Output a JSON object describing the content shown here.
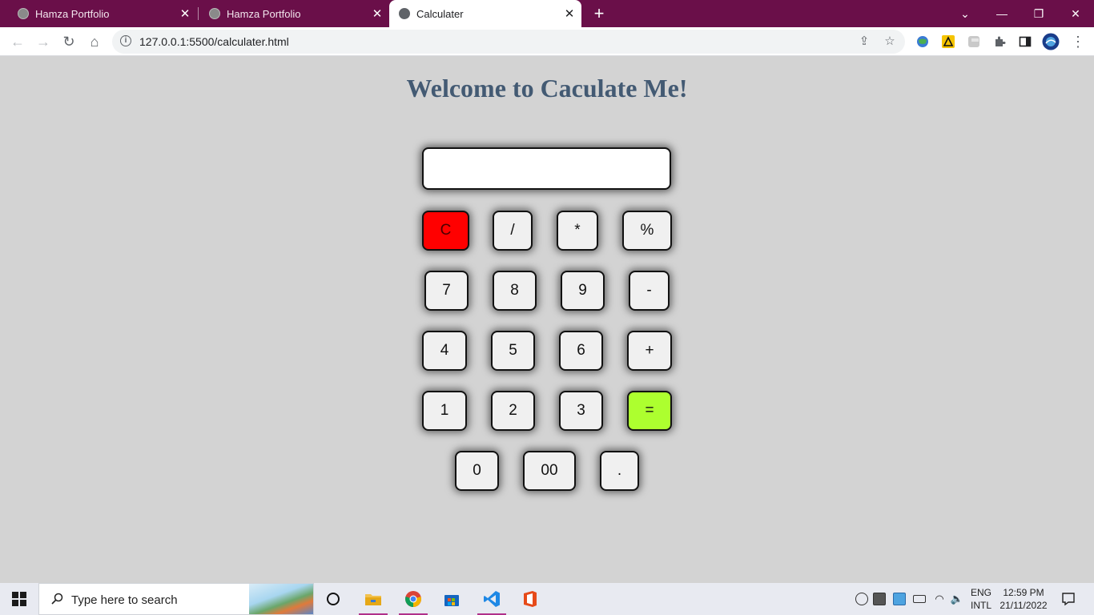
{
  "browser": {
    "tabs": [
      {
        "title": "Hamza Portfolio",
        "active": false
      },
      {
        "title": "Hamza Portfolio",
        "active": false
      },
      {
        "title": "Calculater",
        "active": true
      }
    ],
    "new_tab_label": "+",
    "window_controls": {
      "menu": "⌄",
      "minimize": "—",
      "restore": "❐",
      "close": "✕"
    },
    "url": "127.0.0.1:5500/calculater.html",
    "colors": {
      "tab_strip": "#6a0f49"
    }
  },
  "page": {
    "title": "Welcome to Caculate Me!",
    "display_value": "",
    "keys": [
      {
        "label": "C",
        "name": "clear-button",
        "kind": "clear"
      },
      {
        "label": "/",
        "name": "divide-button",
        "kind": "op"
      },
      {
        "label": "*",
        "name": "multiply-button",
        "kind": "op"
      },
      {
        "label": "%",
        "name": "percent-button",
        "kind": "op"
      },
      {
        "label": "7",
        "name": "digit-7-button",
        "kind": "digit"
      },
      {
        "label": "8",
        "name": "digit-8-button",
        "kind": "digit"
      },
      {
        "label": "9",
        "name": "digit-9-button",
        "kind": "digit"
      },
      {
        "label": "-",
        "name": "subtract-button",
        "kind": "op"
      },
      {
        "label": "4",
        "name": "digit-4-button",
        "kind": "digit"
      },
      {
        "label": "5",
        "name": "digit-5-button",
        "kind": "digit"
      },
      {
        "label": "6",
        "name": "digit-6-button",
        "kind": "digit"
      },
      {
        "label": "+",
        "name": "add-button",
        "kind": "op"
      },
      {
        "label": "1",
        "name": "digit-1-button",
        "kind": "digit"
      },
      {
        "label": "2",
        "name": "digit-2-button",
        "kind": "digit"
      },
      {
        "label": "3",
        "name": "digit-3-button",
        "kind": "digit"
      },
      {
        "label": "=",
        "name": "equals-button",
        "kind": "equals"
      },
      {
        "label": "0",
        "name": "digit-0-button",
        "kind": "digit"
      },
      {
        "label": "00",
        "name": "double-zero-button",
        "kind": "digit"
      },
      {
        "label": ".",
        "name": "decimal-button",
        "kind": "digit"
      }
    ],
    "colors": {
      "background": "#d3d3d3",
      "title": "#435a73",
      "clear": "#ff0000",
      "equals": "#adff2f"
    }
  },
  "taskbar": {
    "search_placeholder": "Type here to search",
    "language": [
      "ENG",
      "INTL"
    ],
    "time": "12:59 PM",
    "date": "21/11/2022"
  }
}
